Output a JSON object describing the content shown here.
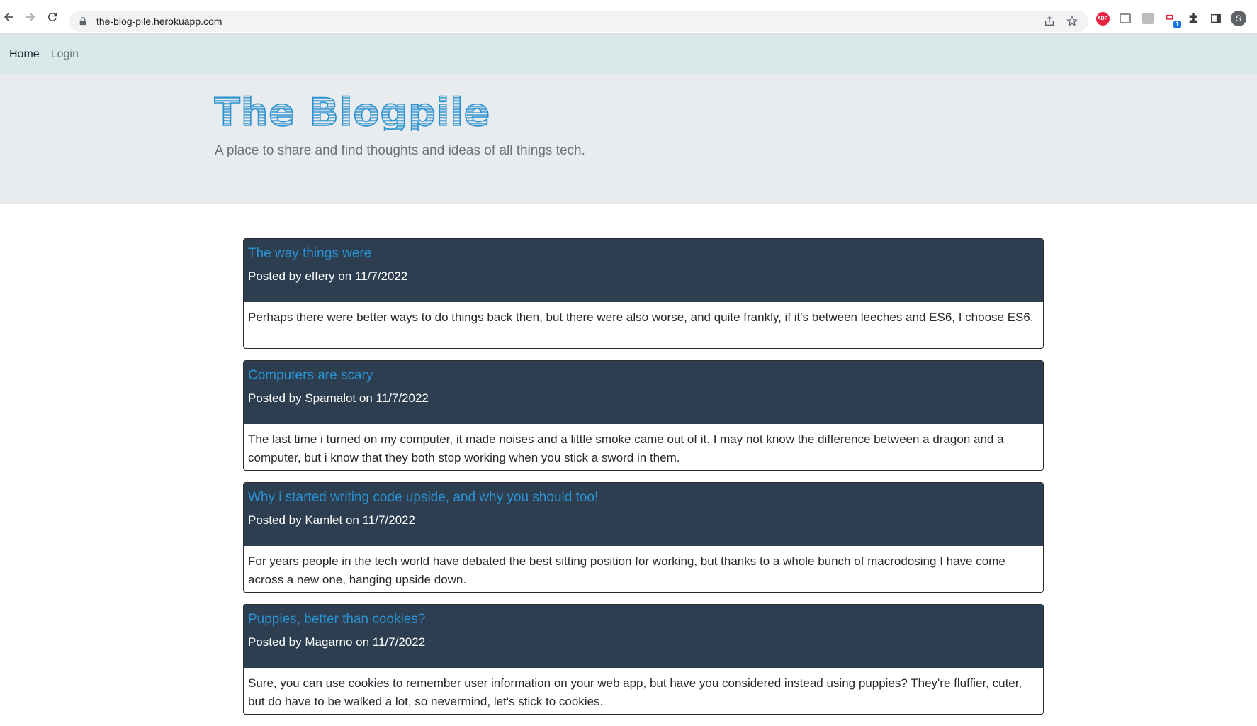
{
  "browser": {
    "url": "the-blog-pile.herokuapp.com",
    "avatar_initial": "S",
    "ext_abp_label": "ABP",
    "ext_badge": "1"
  },
  "nav": {
    "home_label": "Home",
    "login_label": "Login"
  },
  "site": {
    "title": "The Blogpile",
    "subtitle": "A place to share and find thoughts and ideas of all things tech."
  },
  "colors": {
    "navbar_bg": "#d9e8e8",
    "jumbotron_bg": "#e9ecef",
    "logo_color": "#2b92d1",
    "post_header_bg": "#2c3e50",
    "post_title_color": "#2b92d1"
  },
  "posts": [
    {
      "title": "The way things were",
      "meta": "Posted by effery on 11/7/2022",
      "body": "Perhaps there were better ways to do things back then, but there were also worse, and quite frankly, if it's between leeches and ES6, I choose ES6."
    },
    {
      "title": "Computers are scary",
      "meta": "Posted by Spamalot on 11/7/2022",
      "body": "The last time i turned on my computer, it made noises and a little smoke came out of it. I may not know the difference between a dragon and a computer, but i know that they both stop working when you stick a sword in them."
    },
    {
      "title": "Why i started writing code upside, and why you should too!",
      "meta": "Posted by Kamlet on 11/7/2022",
      "body": "For years people in the tech world have debated the best sitting position for working, but thanks to a whole bunch of macrodosing I have come across a new one, hanging upside down."
    },
    {
      "title": "Puppies, better than cookies?",
      "meta": "Posted by Magarno on 11/7/2022",
      "body": "Sure, you can use cookies to remember user information on your web app, but have you considered instead using puppies? They're fluffier, cuter, but do have to be walked a lot, so nevermind, let's stick to cookies."
    }
  ]
}
